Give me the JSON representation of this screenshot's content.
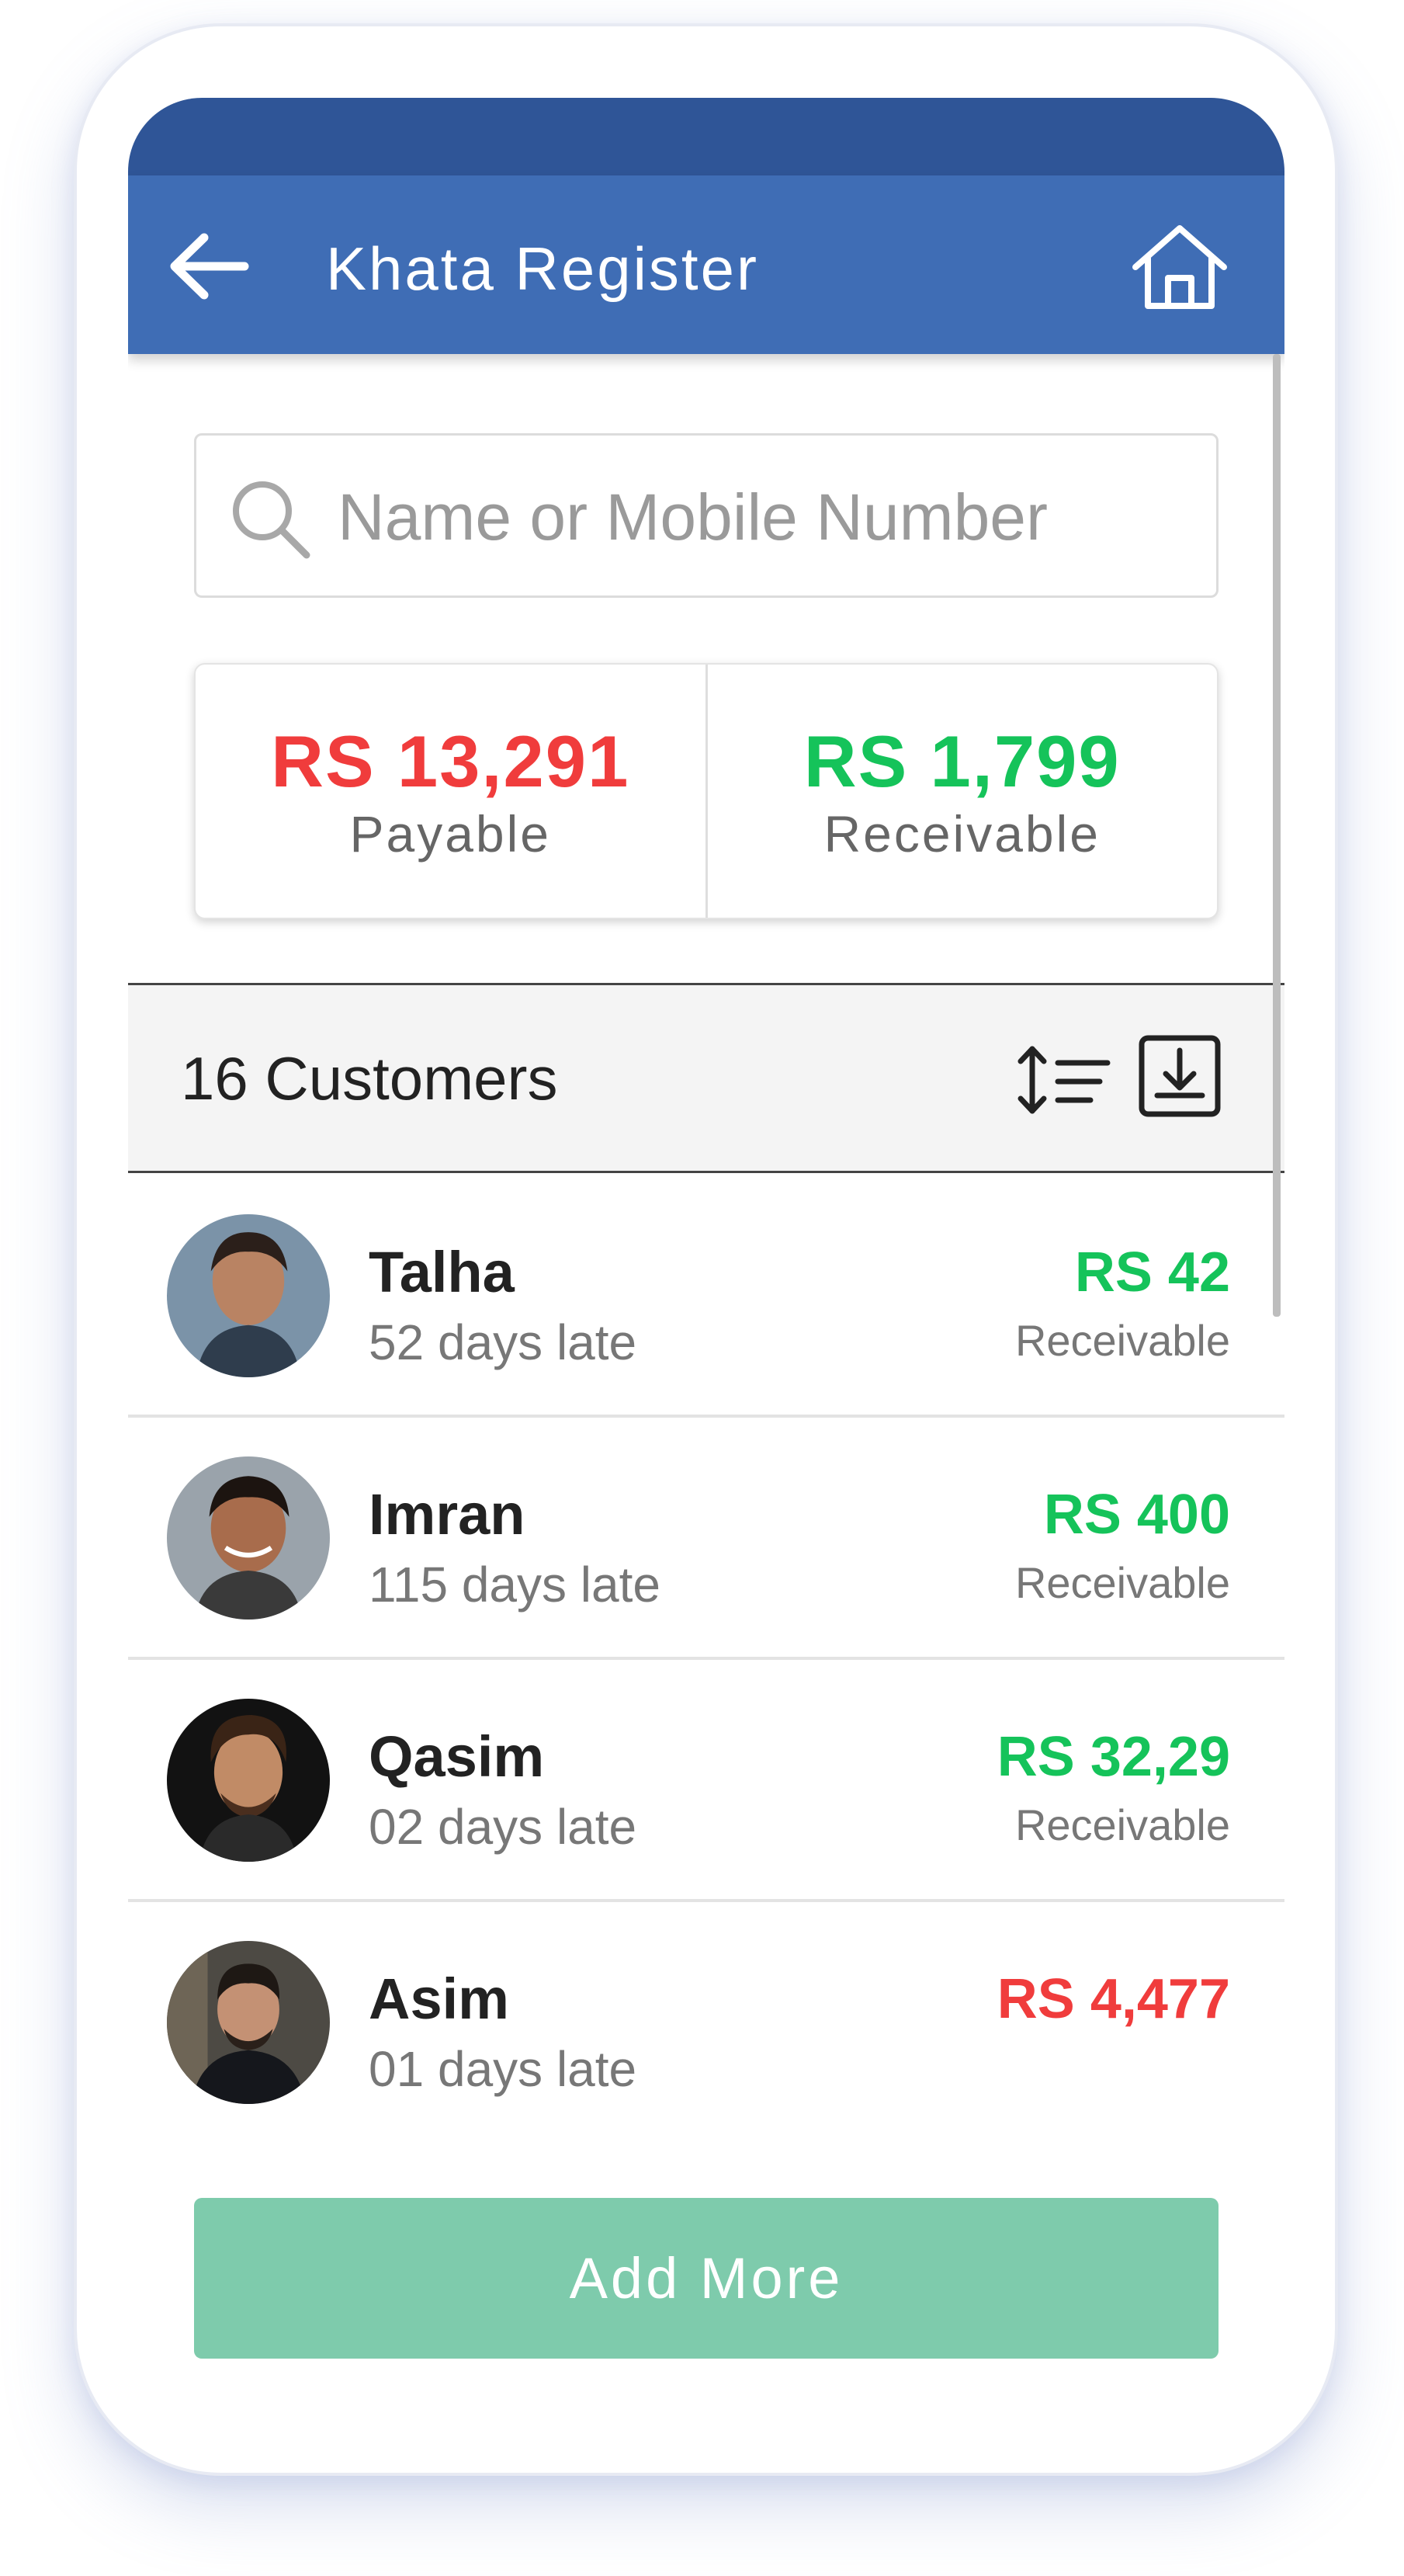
{
  "app_bar": {
    "title": "Khata Register",
    "back_icon": "arrow-left-icon",
    "home_icon": "home-icon",
    "color": "#3f6db5",
    "status_bar_color": "#2f5597"
  },
  "search": {
    "placeholder": "Name or Mobile Number",
    "value": "",
    "icon": "search-icon"
  },
  "summary": {
    "payable": {
      "amount": "RS 13,291",
      "label": "Payable",
      "color": "#f03c3c"
    },
    "receivable": {
      "amount": "RS 1,799",
      "label": "Receivable",
      "color": "#15c35a"
    }
  },
  "customers_bar": {
    "count_label": "16 Customers",
    "sort_icon": "sort-icon",
    "download_icon": "download-icon"
  },
  "customers": [
    {
      "name": "Talha",
      "status": "52 days late",
      "amount": "RS 42",
      "type": "Receivable",
      "amount_color": "#15c35a",
      "avatar_icon": "avatar-photo"
    },
    {
      "name": "Imran",
      "status": "115 days late",
      "amount": "RS 400",
      "type": "Receivable",
      "amount_color": "#15c35a",
      "avatar_icon": "avatar-photo"
    },
    {
      "name": "Qasim",
      "status": "02 days late",
      "amount": "RS 32,29",
      "type": "Receivable",
      "amount_color": "#15c35a",
      "avatar_icon": "avatar-photo"
    },
    {
      "name": "Asim",
      "status": "01 days late",
      "amount": "RS 4,477",
      "type": "",
      "amount_color": "#f03c3c",
      "avatar_icon": "avatar-photo"
    }
  ],
  "add_more": {
    "label": "Add More",
    "color": "#7ecbac"
  }
}
